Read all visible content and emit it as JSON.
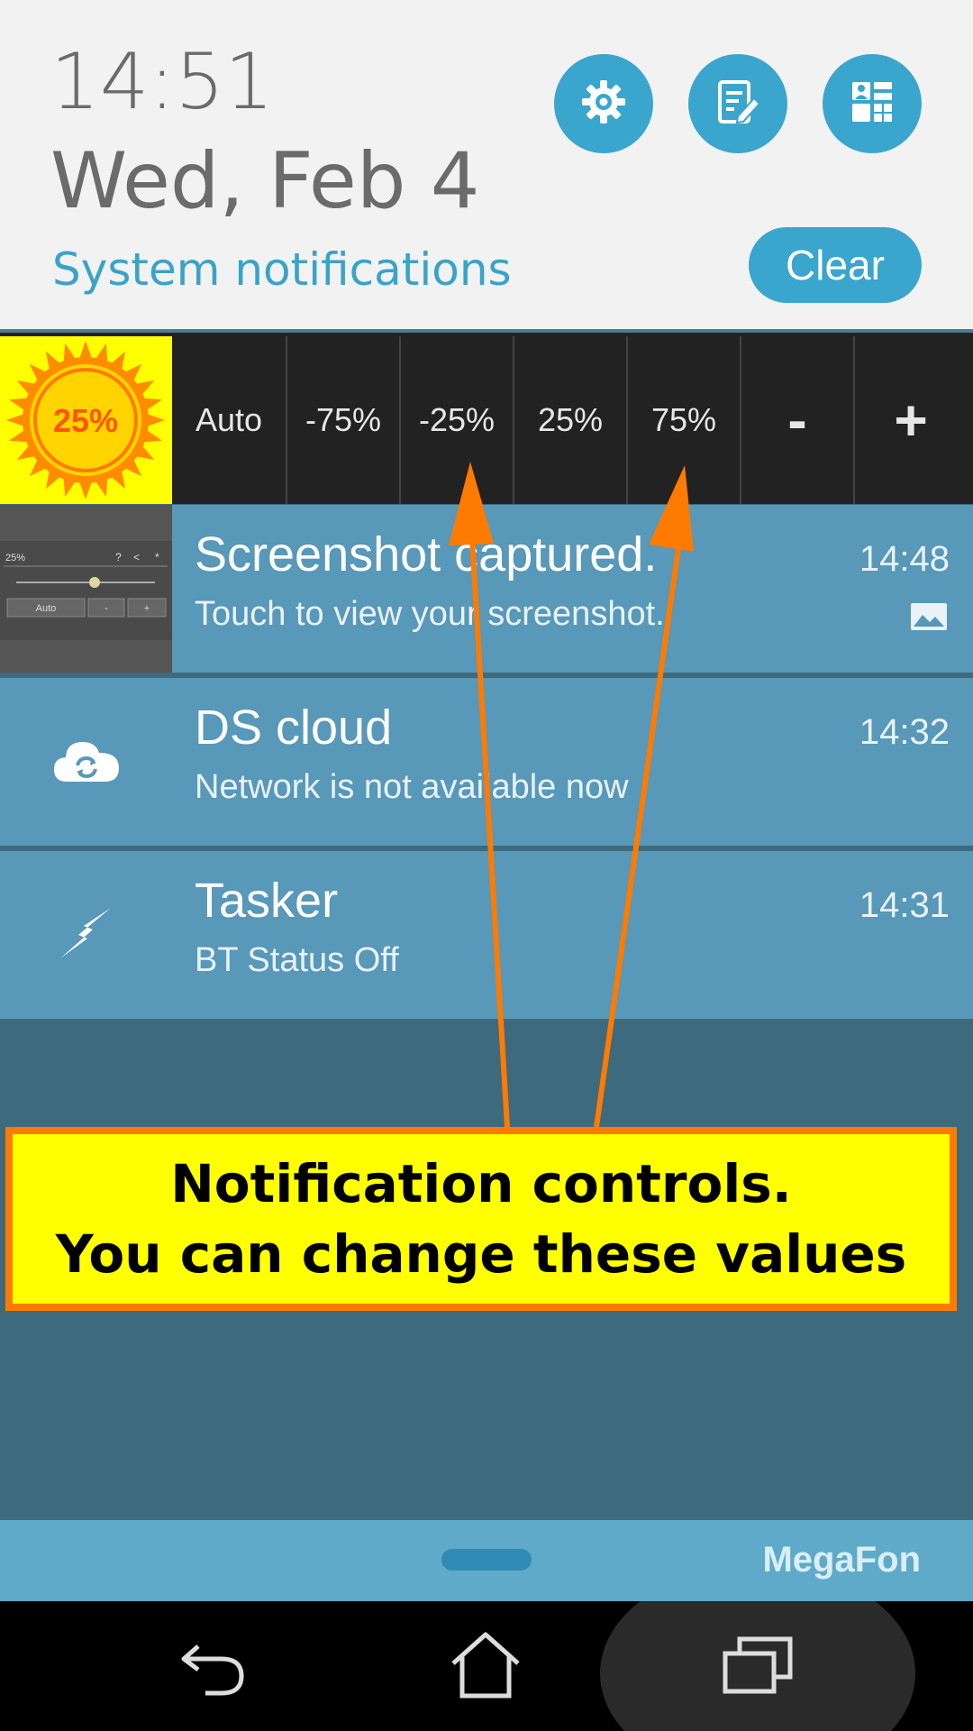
{
  "header": {
    "time": "14:51",
    "date": "Wed, Feb 4",
    "section_title": "System notifications",
    "clear_label": "Clear",
    "quick_buttons": [
      "settings-icon",
      "notes-edit-icon",
      "app-grid-icon"
    ],
    "accent_color": "#3aa6cd"
  },
  "brightness": {
    "current": "25%",
    "levels": [
      "Auto",
      "-75%",
      "-25%",
      "25%",
      "75%",
      "-",
      "+"
    ]
  },
  "notifications": [
    {
      "title": "Screenshot captured.",
      "subtitle": "Touch to view your screenshot.",
      "time": "14:48",
      "icon": "screenshot-thumbnail"
    },
    {
      "title": "DS cloud",
      "subtitle": "Network is not available now",
      "time": "14:32",
      "icon": "cloud-sync-icon"
    },
    {
      "title": "Tasker",
      "subtitle": "BT Status Off",
      "time": "14:31",
      "icon": "lightning-icon"
    }
  ],
  "thumbnail": {
    "label": "25%",
    "buttons": [
      "Auto",
      "-",
      "+"
    ]
  },
  "callout": {
    "line1": "Notification controls.",
    "line2": "You can change these values"
  },
  "carrier": "MegaFon",
  "nav": [
    "back-icon",
    "home-icon",
    "recents-icon"
  ]
}
